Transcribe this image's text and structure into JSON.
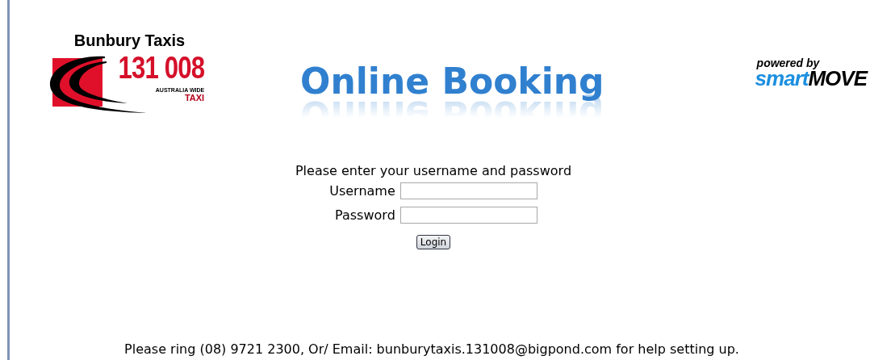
{
  "logo": {
    "company": "Bunbury Taxis",
    "phone": "131 008",
    "tagline": "AUSTRALIA WIDE",
    "word": "TAXI"
  },
  "title": "Online Booking",
  "powered": {
    "label": "powered by",
    "brand_light": "smart",
    "brand_bold": "MOVE"
  },
  "form": {
    "prompt": "Please enter your username and password",
    "fields": [
      {
        "label": "Username"
      },
      {
        "label": "Password"
      }
    ],
    "button": "Login"
  },
  "footer": "Please ring (08) 9721 2300, Or/ Email: bunburytaxis.131008@bigpond.com for help setting up."
}
